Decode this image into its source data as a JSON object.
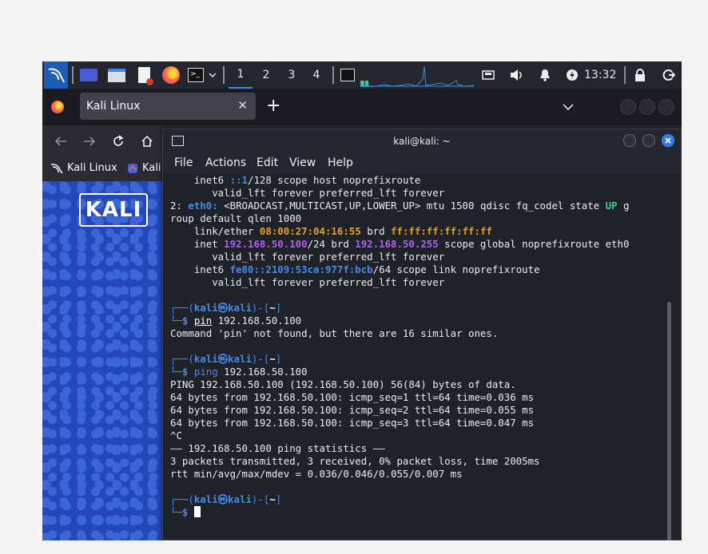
{
  "panel": {
    "workspaces": [
      "1",
      "2",
      "3",
      "4"
    ],
    "clock": "13:32"
  },
  "browser": {
    "tab_title": "Kali Linux",
    "new_tab": "+",
    "bookmarks": [
      "Kali Linux",
      "Kali"
    ],
    "logo_text": "KALI"
  },
  "terminal": {
    "title": "kali@kali: ~",
    "menu": [
      "File",
      "Actions",
      "Edit",
      "View",
      "Help"
    ],
    "prompt": {
      "user": "kali",
      "host": "kali",
      "dir": "~"
    },
    "out": {
      "inet6_lo": [
        "    inet6 ",
        "::1",
        "/128 scope host noprefixroute"
      ],
      "valid1": "       valid_lft forever preferred_lft forever",
      "eth0_a": "2: ",
      "eth0_name": "eth0:",
      "eth0_b": " <BROADCAST,MULTICAST,UP,LOWER_UP> mtu 1500 qdisc fq_codel state ",
      "eth0_up": "UP",
      "eth0_c": " g",
      "eth0_cont": "roup default qlen 1000",
      "link_a": "    link/ether ",
      "link_mac": "08:00:27:04:16:55",
      "link_b": " brd ",
      "link_brd": "ff:ff:ff:ff:ff:ff",
      "inet_a": "    inet ",
      "inet_ip": "192.168.50.100",
      "inet_b": "/24 brd ",
      "inet_brd": "192.168.50.255",
      "inet_c": " scope global noprefixroute eth0",
      "valid2": "       valid_lft forever preferred_lft forever",
      "inet6_a": "    inet6 ",
      "inet6_ip": "fe80::2109:53ca:977f:bcb",
      "inet6_b": "/64 scope link noprefixroute",
      "valid3": "       valid_lft forever preferred_lft forever",
      "cmd1": "pin",
      "cmd1_arg": " 192.168.50.100",
      "cmd1_err": "Command 'pin' not found, but there are 16 similar ones.",
      "cmd2": "ping",
      "cmd2_arg": " 192.168.50.100",
      "ping_head": "PING 192.168.50.100 (192.168.50.100) 56(84) bytes of data.",
      "ping1": "64 bytes from 192.168.50.100: icmp_seq=1 ttl=64 time=0.036 ms",
      "ping2": "64 bytes from 192.168.50.100: icmp_seq=2 ttl=64 time=0.055 ms",
      "ping3": "64 bytes from 192.168.50.100: icmp_seq=3 ttl=64 time=0.047 ms",
      "ctrlc": "^C",
      "stats_head": "—— 192.168.50.100 ping statistics ——",
      "stats1": "3 packets transmitted, 3 received, 0% packet loss, time 2005ms",
      "stats2": "rtt min/avg/max/mdev = 0.036/0.046/0.055/0.007 ms"
    }
  },
  "colors": {
    "accent": "#3f8cf0",
    "ip_purple": "#b45ef0",
    "mac_orange": "#e6a21e",
    "state_green": "#2fd58a"
  }
}
